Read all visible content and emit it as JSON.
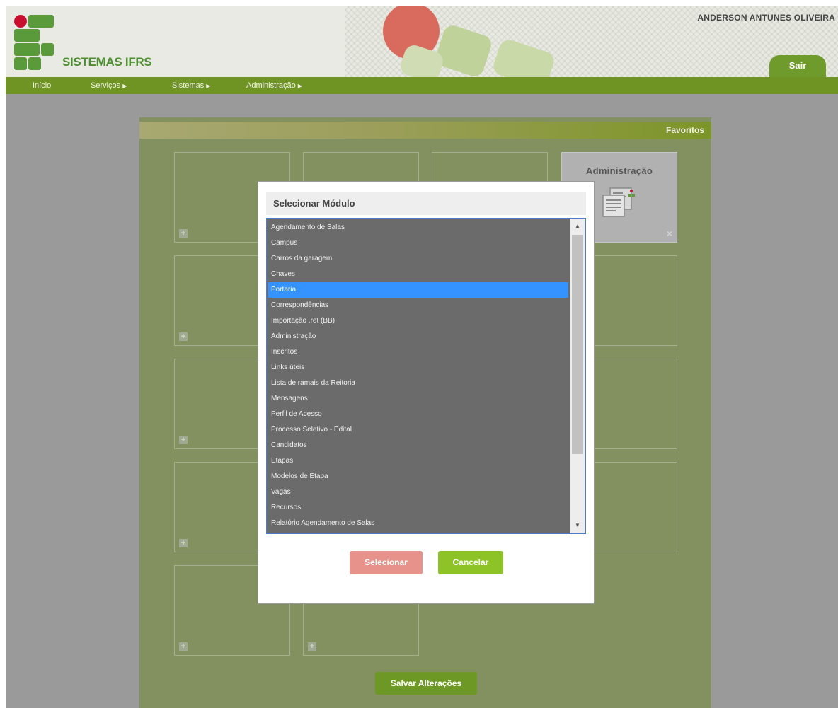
{
  "header": {
    "brand": "SISTEMAS IFRS",
    "user_name": "ANDERSON ANTUNES OLIVEIRA",
    "logout_label": "Sair"
  },
  "menu": {
    "items": [
      {
        "label": "Início",
        "has_submenu": false
      },
      {
        "label": "Serviços",
        "has_submenu": true
      },
      {
        "label": "Sistemas",
        "has_submenu": true
      },
      {
        "label": "Administração",
        "has_submenu": true
      }
    ]
  },
  "favorites": {
    "title": "Favoritos",
    "admin_tile_title": "Administração",
    "add_symbol": "+",
    "remove_symbol": "×",
    "save_label": "Salvar Alterações"
  },
  "modal": {
    "title": "Selecionar Módulo",
    "selected_index": 4,
    "options": [
      "Agendamento de Salas",
      "Campus",
      "Carros da garagem",
      "Chaves",
      "Portaria",
      "Correspondências",
      "Importação .ret (BB)",
      "Administração",
      "Inscritos",
      "Links úteis",
      "Lista de ramais da Reitoria",
      "Mensagens",
      "Perfil de Acesso",
      "Processo Seletivo - Edital",
      "Candidatos",
      "Etapas",
      "Modelos de Etapa",
      "Vagas",
      "Recursos",
      "Relatório Agendamento de Salas"
    ],
    "select_label": "Selecionar",
    "cancel_label": "Cancelar"
  },
  "colors": {
    "menu_green": "#6f9424",
    "selected_option": "#3593ff",
    "select_button": "#e8928c",
    "cancel_button": "#8ec328"
  }
}
